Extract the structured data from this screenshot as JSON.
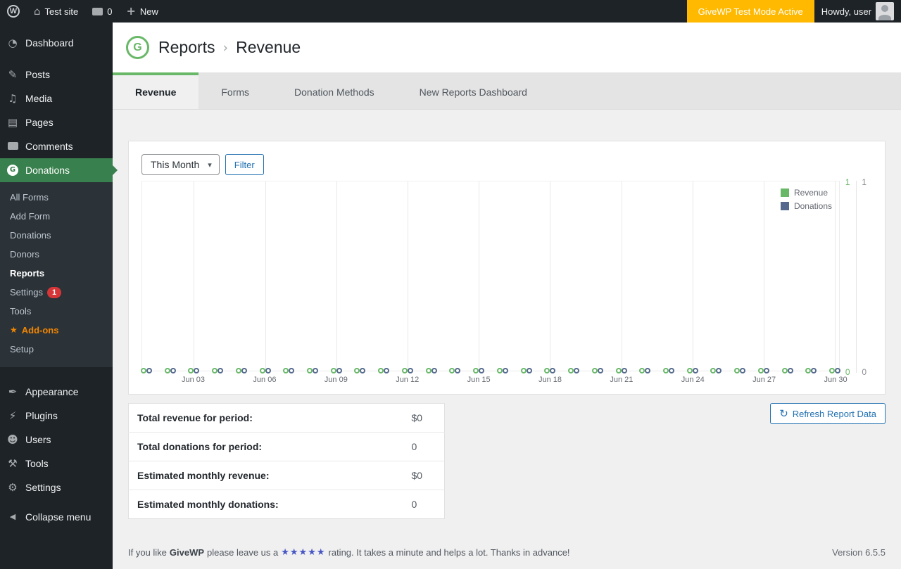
{
  "admin_bar": {
    "site_name": "Test site",
    "comments_count": "0",
    "new_label": "New",
    "test_mode_badge": "GiveWP Test Mode Active",
    "howdy": "Howdy, user"
  },
  "icons": {
    "wp_logo": "W",
    "home": "⌂",
    "plus": "+",
    "give_logo": "G",
    "dashboard": "◔",
    "posts": "✎",
    "media": "♫",
    "pages": "▤",
    "appearance": "✒",
    "plugins": "⚡",
    "users": "☻",
    "tools": "⚒",
    "settings": "⚙",
    "collapse": "◀",
    "chevron_down": "▾",
    "refresh": "↻",
    "addons_star": "★",
    "breadcrumb_sep": "›"
  },
  "sidebar": {
    "items": [
      {
        "label": "Dashboard"
      },
      {
        "label": "Posts"
      },
      {
        "label": "Media"
      },
      {
        "label": "Pages"
      },
      {
        "label": "Comments"
      },
      {
        "label": "Donations",
        "active": true
      },
      {
        "label": "Appearance"
      },
      {
        "label": "Plugins"
      },
      {
        "label": "Users"
      },
      {
        "label": "Tools"
      },
      {
        "label": "Settings"
      },
      {
        "label": "Collapse menu"
      }
    ],
    "submenu": [
      {
        "label": "All Forms"
      },
      {
        "label": "Add Form"
      },
      {
        "label": "Donations"
      },
      {
        "label": "Donors"
      },
      {
        "label": "Reports",
        "current": true
      },
      {
        "label": "Settings",
        "badge": "1"
      },
      {
        "label": "Tools"
      },
      {
        "label": "Add-ons",
        "highlight": "orange"
      },
      {
        "label": "Setup"
      }
    ]
  },
  "header": {
    "breadcrumb_root": "Reports",
    "breadcrumb_current": "Revenue"
  },
  "tabs": [
    {
      "label": "Revenue",
      "active": true
    },
    {
      "label": "Forms"
    },
    {
      "label": "Donation Methods"
    },
    {
      "label": "New Reports Dashboard"
    }
  ],
  "filters": {
    "period_value": "This Month",
    "filter_button": "Filter"
  },
  "chart_data": {
    "type": "scatter",
    "title": "Revenue and Donations for This Month",
    "x": [
      "Jun 01",
      "Jun 02",
      "Jun 03",
      "Jun 04",
      "Jun 05",
      "Jun 06",
      "Jun 07",
      "Jun 08",
      "Jun 09",
      "Jun 10",
      "Jun 11",
      "Jun 12",
      "Jun 13",
      "Jun 14",
      "Jun 15",
      "Jun 16",
      "Jun 17",
      "Jun 18",
      "Jun 19",
      "Jun 20",
      "Jun 21",
      "Jun 22",
      "Jun 23",
      "Jun 24",
      "Jun 25",
      "Jun 26",
      "Jun 27",
      "Jun 28",
      "Jun 29",
      "Jun 30"
    ],
    "x_tick_labels": [
      "Jun 03",
      "Jun 06",
      "Jun 09",
      "Jun 12",
      "Jun 15",
      "Jun 18",
      "Jun 21",
      "Jun 24",
      "Jun 27",
      "Jun 30"
    ],
    "series": [
      {
        "name": "Revenue",
        "color": "#69b868",
        "values": [
          0,
          0,
          0,
          0,
          0,
          0,
          0,
          0,
          0,
          0,
          0,
          0,
          0,
          0,
          0,
          0,
          0,
          0,
          0,
          0,
          0,
          0,
          0,
          0,
          0,
          0,
          0,
          0,
          0,
          0
        ]
      },
      {
        "name": "Donations",
        "color": "#54698d",
        "values": [
          0,
          0,
          0,
          0,
          0,
          0,
          0,
          0,
          0,
          0,
          0,
          0,
          0,
          0,
          0,
          0,
          0,
          0,
          0,
          0,
          0,
          0,
          0,
          0,
          0,
          0,
          0,
          0,
          0,
          0
        ]
      }
    ],
    "ylim": [
      0,
      1
    ],
    "y_axes": [
      {
        "name": "revenue-axis",
        "color": "#69b868",
        "min": 0,
        "max": 1
      },
      {
        "name": "donations-axis",
        "color": "#8c8f94",
        "min": 0,
        "max": 1
      }
    ],
    "grid": "vertical",
    "legend_position": "top-right"
  },
  "summary": {
    "rows": [
      {
        "label": "Total revenue for period:",
        "value": "$0"
      },
      {
        "label": "Total donations for period:",
        "value": "0"
      },
      {
        "label": "Estimated monthly revenue:",
        "value": "$0"
      },
      {
        "label": "Estimated monthly donations:",
        "value": "0"
      }
    ]
  },
  "actions": {
    "refresh_button": "Refresh Report Data"
  },
  "footer": {
    "like_prefix": "If you like",
    "brand": "GiveWP",
    "like_middle": "please leave us a",
    "stars": "★★★★★",
    "like_suffix": "rating. It takes a minute and helps a lot. Thanks in advance!",
    "version": "Version 6.5.5"
  },
  "colors": {
    "accent_green": "#69b868",
    "donations_blue": "#54698d",
    "link_blue": "#2271b1",
    "menu_active_green": "#38804d",
    "test_mode_orange": "#ffb900",
    "badge_red": "#d63638",
    "addons_orange": "#f18500",
    "stars_blue": "#4655c4"
  }
}
